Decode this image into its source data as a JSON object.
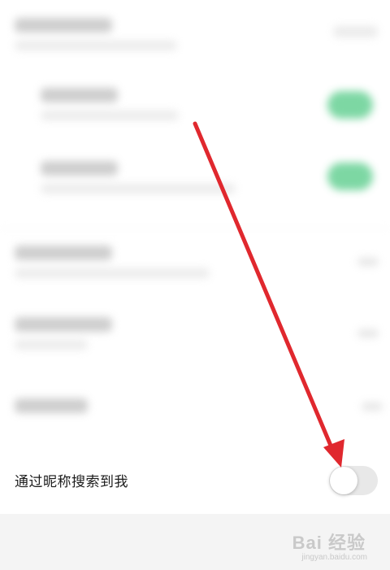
{
  "privacy_list": {
    "search_by_nickname": {
      "label": "通过昵称搜索到我",
      "enabled": false
    }
  },
  "watermark": {
    "text": "Bai 经验",
    "sub": "jingyan.baidu.com"
  },
  "annotation": {
    "arrow_color": "#e0282e"
  }
}
